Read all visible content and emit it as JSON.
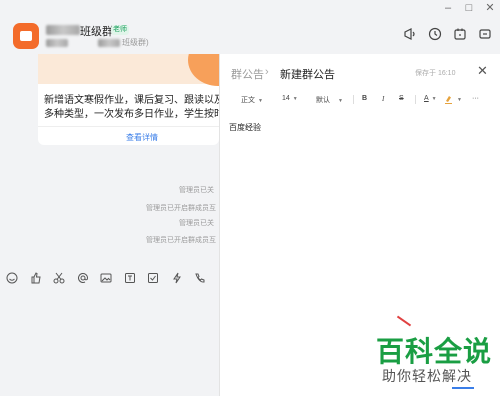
{
  "window": {
    "minimize": "–",
    "maximize": "□",
    "close": "✕"
  },
  "header": {
    "group_name": "班级群",
    "badge": "老师",
    "group_subtitle": "班级群)"
  },
  "card": {
    "line1": "新增语文寒假作业，课后复习、跟读以及背",
    "line2": "多种类型，一次发布多日作业，学生按时提",
    "link": "查看详情"
  },
  "system_messages": [
    "管理员已关",
    "管理员已开启群成员互",
    "管理员已关",
    "管理员已开启群成员互"
  ],
  "panel": {
    "crumb_parent": "群公告",
    "crumb_title": "新建群公告",
    "save_status": "保存于 16:10",
    "close": "✕",
    "toolbar": {
      "style": "正文",
      "size": "14",
      "font": "默认",
      "bold": "B",
      "italic": "I",
      "strike": "S",
      "text_color": "A",
      "more": "···"
    },
    "content": "百度经验"
  },
  "watermark": {
    "title": "百科全说",
    "subtitle": "助你轻松解决"
  },
  "colors": {
    "accent_orange": "#f36b2a",
    "link_blue": "#3a7ee8",
    "brand_green": "#1a9e43"
  }
}
